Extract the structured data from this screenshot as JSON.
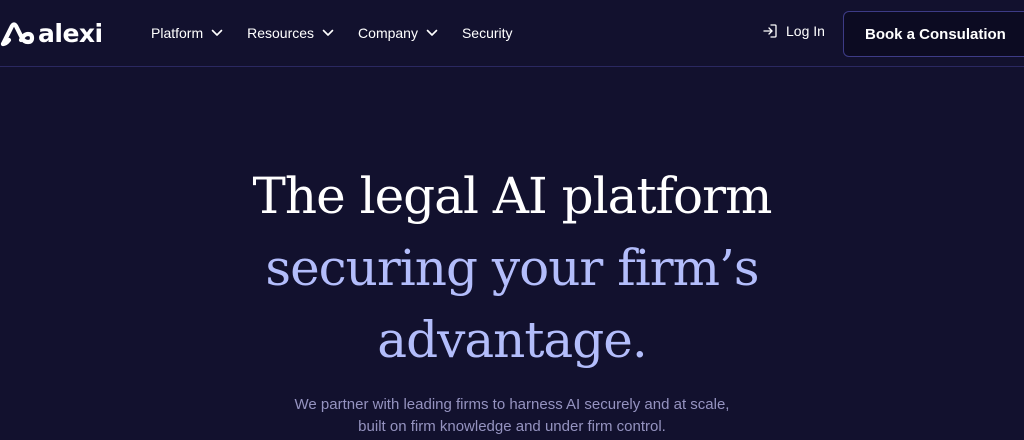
{
  "brand": {
    "name": "alexi",
    "icon": "alexi-logo-mark"
  },
  "nav": {
    "items": [
      {
        "label": "Platform",
        "has_dropdown": true
      },
      {
        "label": "Resources",
        "has_dropdown": true
      },
      {
        "label": "Company",
        "has_dropdown": true
      },
      {
        "label": "Security",
        "has_dropdown": false
      }
    ],
    "login_label": "Log In",
    "login_icon": "login-icon",
    "cta_label": "Book a Consulation"
  },
  "hero": {
    "headline_line1": "The legal AI platform",
    "headline_line2": "securing your firm’s",
    "headline_line3": "advantage.",
    "subtext_line1": "We partner with leading firms to harness AI securely and at scale,",
    "subtext_line2": "built on firm knowledge and under firm control."
  },
  "colors": {
    "background": "#12112e",
    "accent_headline": "#b3bdfb",
    "subtext": "#9593c0",
    "cta_border": "#3d3b86"
  }
}
